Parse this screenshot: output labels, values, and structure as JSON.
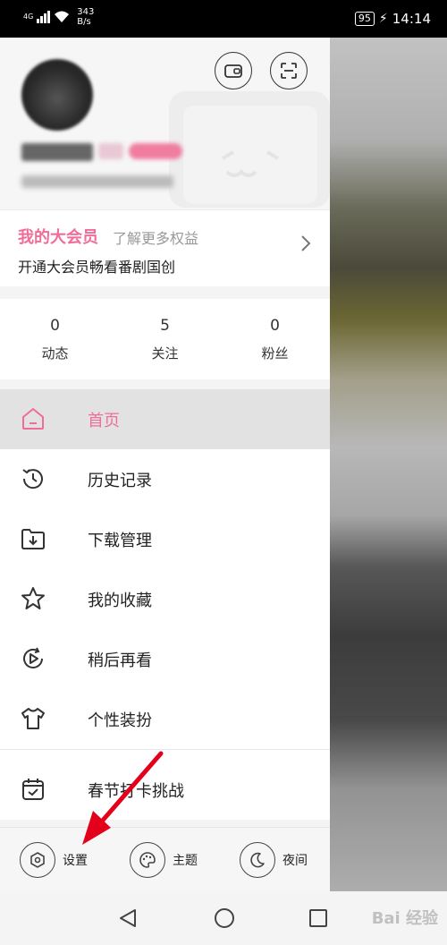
{
  "status_bar": {
    "network": "4G",
    "speed_value": "343",
    "speed_unit": "B/s",
    "battery": "95",
    "time": "14:14"
  },
  "vip": {
    "title": "我的大会员",
    "more": "了解更多权益",
    "description": "开通大会员畅看番剧国创"
  },
  "counts": [
    {
      "value": "0",
      "label": "动态"
    },
    {
      "value": "5",
      "label": "关注"
    },
    {
      "value": "0",
      "label": "粉丝"
    }
  ],
  "menu": [
    {
      "label": "首页",
      "icon": "home-icon",
      "active": true
    },
    {
      "label": "历史记录",
      "icon": "history-icon"
    },
    {
      "label": "下载管理",
      "icon": "download-folder-icon"
    },
    {
      "label": "我的收藏",
      "icon": "star-icon"
    },
    {
      "label": "稍后再看",
      "icon": "watch-later-icon"
    },
    {
      "label": "个性装扮",
      "icon": "tshirt-icon"
    },
    {
      "label": "春节打卡挑战",
      "icon": "calendar-check-icon"
    }
  ],
  "bottom": {
    "settings": "设置",
    "theme": "主题",
    "night": "夜间"
  },
  "watermark": "Bai 经验",
  "colors": {
    "accent": "#f06d98",
    "arrow": "#e3001b"
  }
}
